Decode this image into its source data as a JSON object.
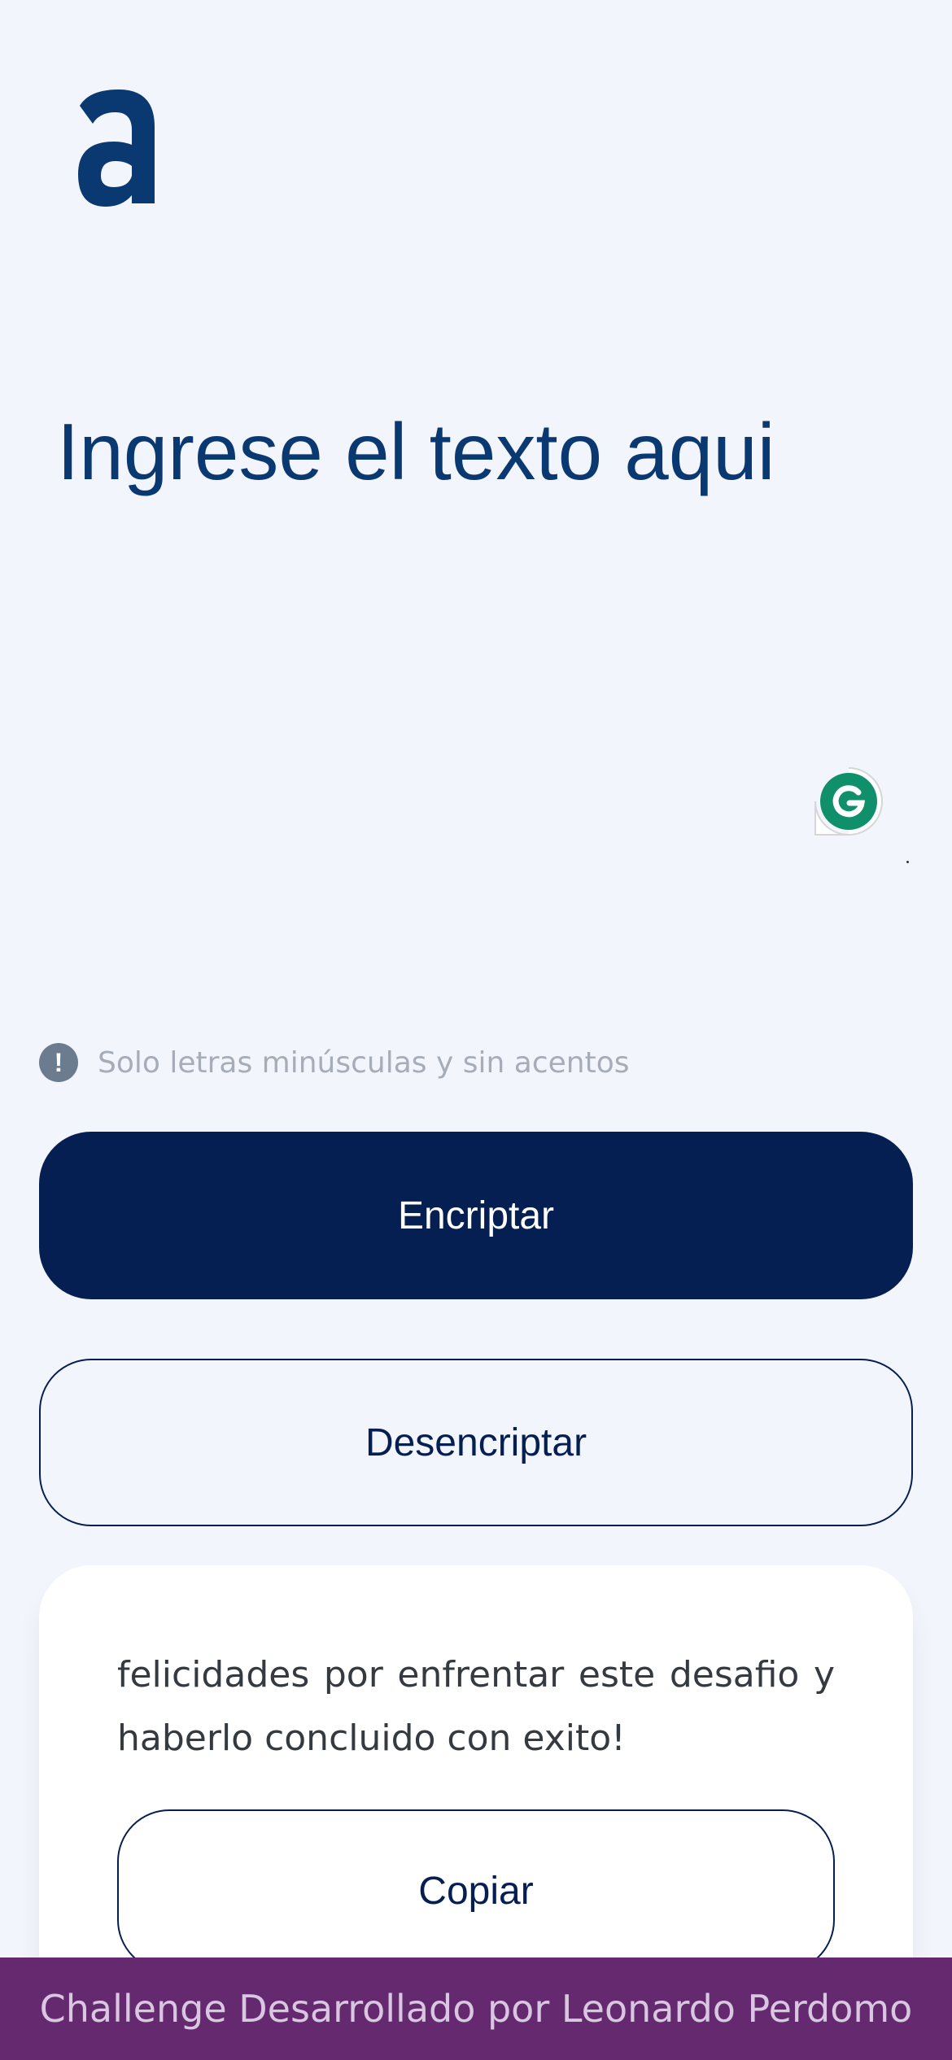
{
  "brand": {
    "logo_letter": "a",
    "logo_color": "#0a3871"
  },
  "input": {
    "placeholder": "Ingrese el texto aqui",
    "value": ""
  },
  "hint": {
    "icon": "exclamation-icon",
    "text": "Solo letras minúsculas y sin acentos"
  },
  "buttons": {
    "encrypt_label": "Encriptar",
    "decrypt_label": "Desencriptar"
  },
  "result": {
    "text": "felicidades por enfrentar este desafio y haberlo concluido con exito!",
    "copy_label": "Copiar"
  },
  "extension": {
    "icon": "grammarly-icon",
    "color": "#0f8f6a"
  },
  "footer": {
    "text": "Challenge Desarrollado por Leonardo Perdomo",
    "background": "#64296e"
  },
  "colors": {
    "primary": "#061f52",
    "page_background": "#f3f5fc"
  }
}
